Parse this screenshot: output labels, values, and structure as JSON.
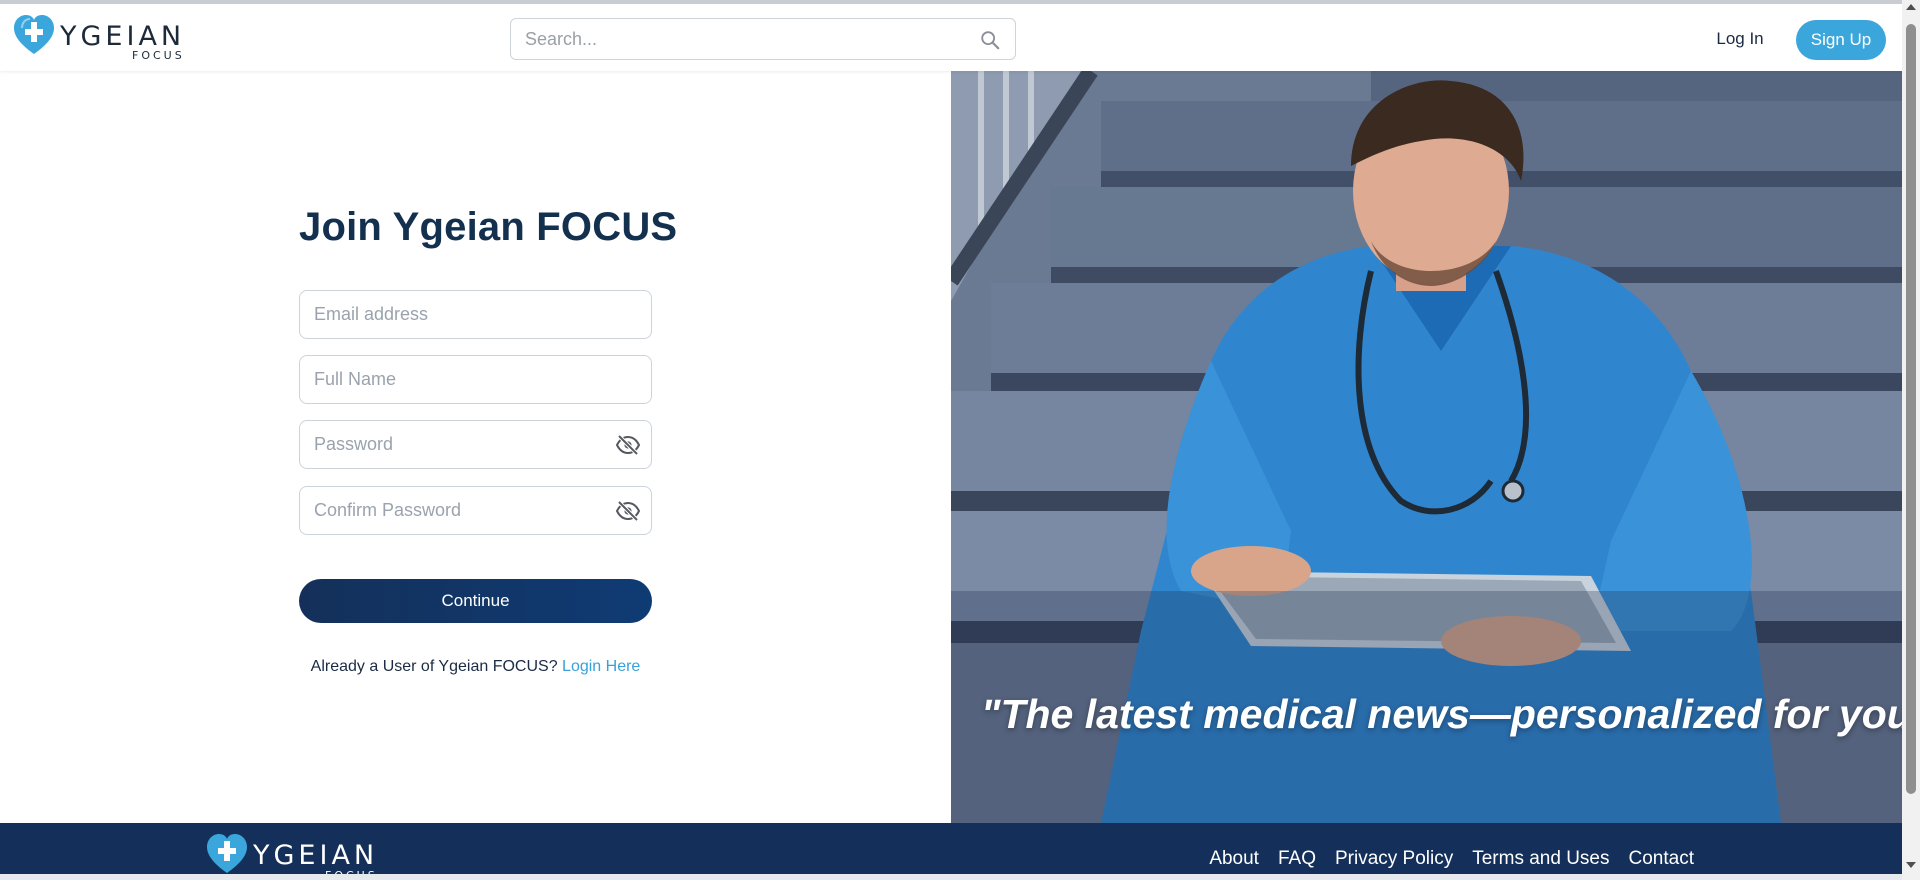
{
  "brand": {
    "name": "YGEIAN",
    "sub": "FOCUS",
    "accent": "#3aa6db",
    "navy": "#14305a"
  },
  "header": {
    "search_placeholder": "Search...",
    "login_label": "Log In",
    "signup_label": "Sign Up"
  },
  "form": {
    "title": "Join Ygeian FOCUS",
    "email_placeholder": "Email address",
    "fullname_placeholder": "Full Name",
    "password_placeholder": "Password",
    "confirm_placeholder": "Confirm Password",
    "continue_label": "Continue",
    "already_text": "Already a User of Ygeian FOCUS?",
    "login_link": "Login Here"
  },
  "hero": {
    "quote": "\"The latest medical news—personalized for you.\""
  },
  "footer": {
    "links": [
      "About",
      "FAQ",
      "Privacy Policy",
      "Terms and Uses",
      "Contact"
    ]
  },
  "icons": [
    "heart-cross-logo-icon",
    "search-icon",
    "eye-off-icon"
  ]
}
